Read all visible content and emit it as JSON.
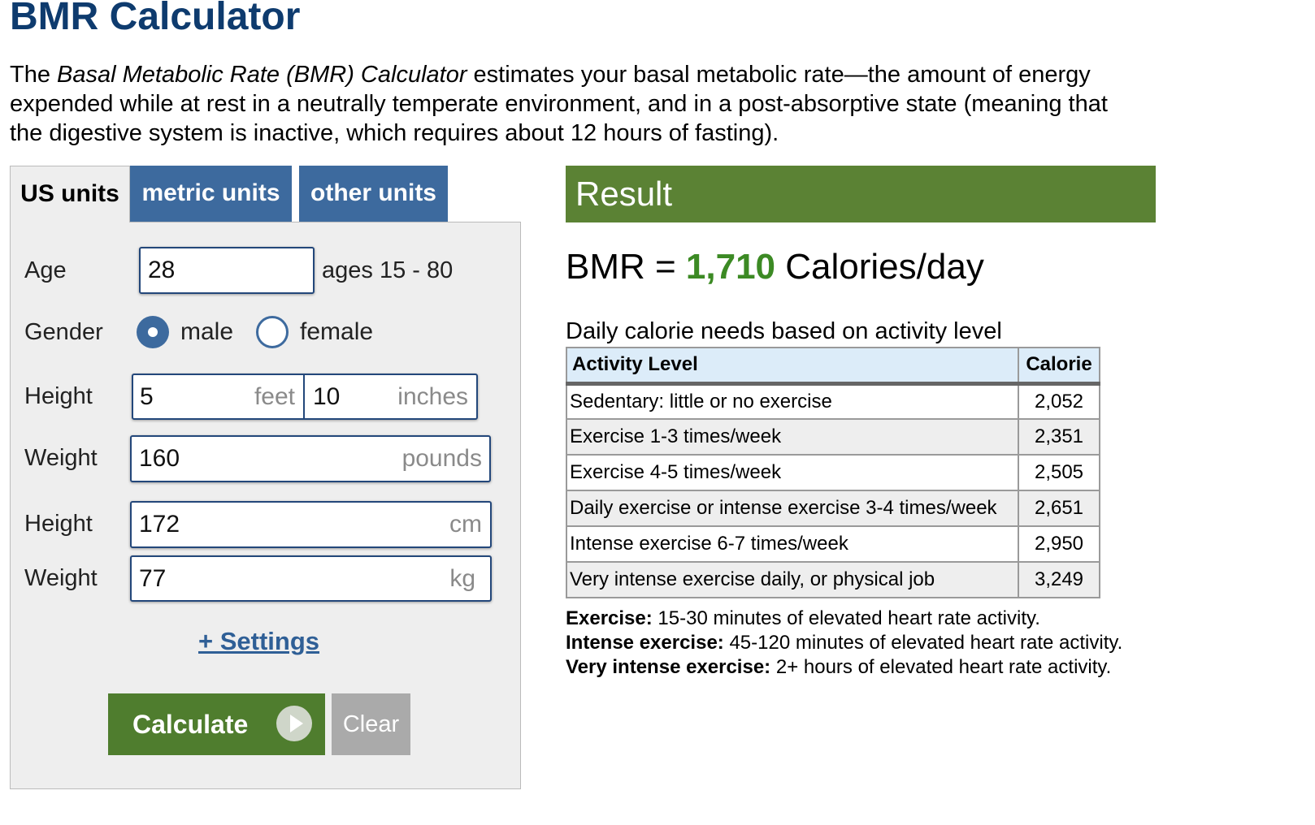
{
  "page": {
    "title": "BMR Calculator"
  },
  "intro": {
    "before": "The ",
    "em": "Basal Metabolic Rate (BMR) Calculator",
    "after": " estimates your basal metabolic rate—the amount of energy expended while at rest in a neutrally temperate environment, and in a post-absorptive state (meaning that the digestive system is inactive, which requires about 12 hours of fasting)."
  },
  "tabs": [
    {
      "label": "US units",
      "active": true
    },
    {
      "label": "metric units",
      "active": false
    },
    {
      "label": "other units",
      "active": false
    }
  ],
  "form": {
    "age": {
      "label": "Age",
      "value": "28",
      "hint": "ages 15 - 80"
    },
    "gender": {
      "label": "Gender",
      "options": [
        {
          "label": "male",
          "selected": true
        },
        {
          "label": "female",
          "selected": false
        }
      ]
    },
    "height_us": {
      "label": "Height",
      "feet_value": "5",
      "feet_unit": "feet",
      "inches_value": "10",
      "inches_unit": "inches"
    },
    "weight_us": {
      "label": "Weight",
      "value": "160",
      "unit": "pounds"
    },
    "height_metric": {
      "label": "Height",
      "value": "172",
      "unit": "cm"
    },
    "weight_metric": {
      "label": "Weight",
      "value": "77",
      "unit": "kg"
    },
    "settings_link": "+ Settings",
    "calculate_label": "Calculate",
    "clear_label": "Clear"
  },
  "result": {
    "header": "Result",
    "bmr_prefix": "BMR = ",
    "bmr_value": "1,710",
    "bmr_suffix": " Calories/day",
    "table_caption": "Daily calorie needs based on activity level",
    "columns": [
      "Activity Level",
      "Calorie"
    ],
    "rows": [
      {
        "activity": "Sedentary: little or no exercise",
        "calorie": "2,052"
      },
      {
        "activity": "Exercise 1-3 times/week",
        "calorie": "2,351"
      },
      {
        "activity": "Exercise 4-5 times/week",
        "calorie": "2,505"
      },
      {
        "activity": "Daily exercise or intense exercise 3-4 times/week",
        "calorie": "2,651"
      },
      {
        "activity": "Intense exercise 6-7 times/week",
        "calorie": "2,950"
      },
      {
        "activity": "Very intense exercise daily, or physical job",
        "calorie": "3,249"
      }
    ],
    "notes": [
      {
        "term": "Exercise:",
        "text": " 15-30 minutes of elevated heart rate activity."
      },
      {
        "term": "Intense exercise:",
        "text": " 45-120 minutes of elevated heart rate activity."
      },
      {
        "term": "Very intense exercise:",
        "text": " 2+ hours of elevated heart rate activity."
      }
    ]
  },
  "icons": {
    "calculate": "play-circle-icon",
    "gender_selected": "radio-selected-icon",
    "gender_unselected": "radio-unselected-icon"
  },
  "colors": {
    "title": "#0e3b6e",
    "tab_inactive_bg": "#3d6a9e",
    "tab_active_bg": "#eeeeee",
    "result_header_bg": "#5b8234",
    "bmr_value": "#3c8a24",
    "calculate_bg": "#4f7d2e",
    "clear_bg": "#aaaaaa",
    "table_header_bg": "#dcecf9",
    "link": "#2f5f96"
  }
}
